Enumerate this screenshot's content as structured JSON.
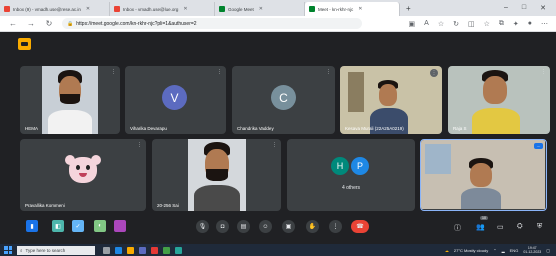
{
  "browser": {
    "tabs": [
      {
        "label": "Inbox (9) - vmadh.use@rese.ac.in",
        "favicon_color": "#ea4335",
        "active": false
      },
      {
        "label": "Inbox - vmadh.use@lue.org",
        "favicon_color": "#ea4335",
        "active": false
      },
      {
        "label": "Google Meet",
        "favicon_color": "#00832d",
        "active": false
      },
      {
        "label": "Meet - kn-rkhr-njc",
        "favicon_color": "#00832d",
        "active": true
      }
    ],
    "new_tab": "+",
    "window_controls": {
      "minimize": "–",
      "maximize": "□",
      "close": "✕"
    },
    "url": "https://meet.google.com/kn-rkhr-njc?pli=1&authuser=2"
  },
  "participants": [
    {
      "name": "HEMA",
      "type": "video"
    },
    {
      "name": "Viharika Devarapu",
      "type": "avatar",
      "initial": "V",
      "color": "#5c6bc0"
    },
    {
      "name": "Chandrika Vaddey",
      "type": "avatar",
      "initial": "C",
      "color": "#78909c"
    },
    {
      "name": "Kesava Murali (22A25A0219)",
      "type": "video"
    },
    {
      "name": "Raja S",
      "type": "video"
    },
    {
      "name": "Pravallika Kommeni",
      "type": "avatar-image"
    },
    {
      "name": "20-256 Sai",
      "type": "video"
    },
    {
      "name": "4 others",
      "type": "others",
      "initials": [
        "H",
        "P"
      ],
      "colors": [
        "#00897b",
        "#1e88e5"
      ]
    },
    {
      "name": "",
      "type": "self-video"
    }
  ],
  "controls": {
    "participant_count": "10"
  },
  "taskbar": {
    "search_placeholder": "Type here to search",
    "weather": "27°C Mostly cloudy",
    "language": "ENG",
    "time": "19:47",
    "date": "01-12-2023"
  }
}
